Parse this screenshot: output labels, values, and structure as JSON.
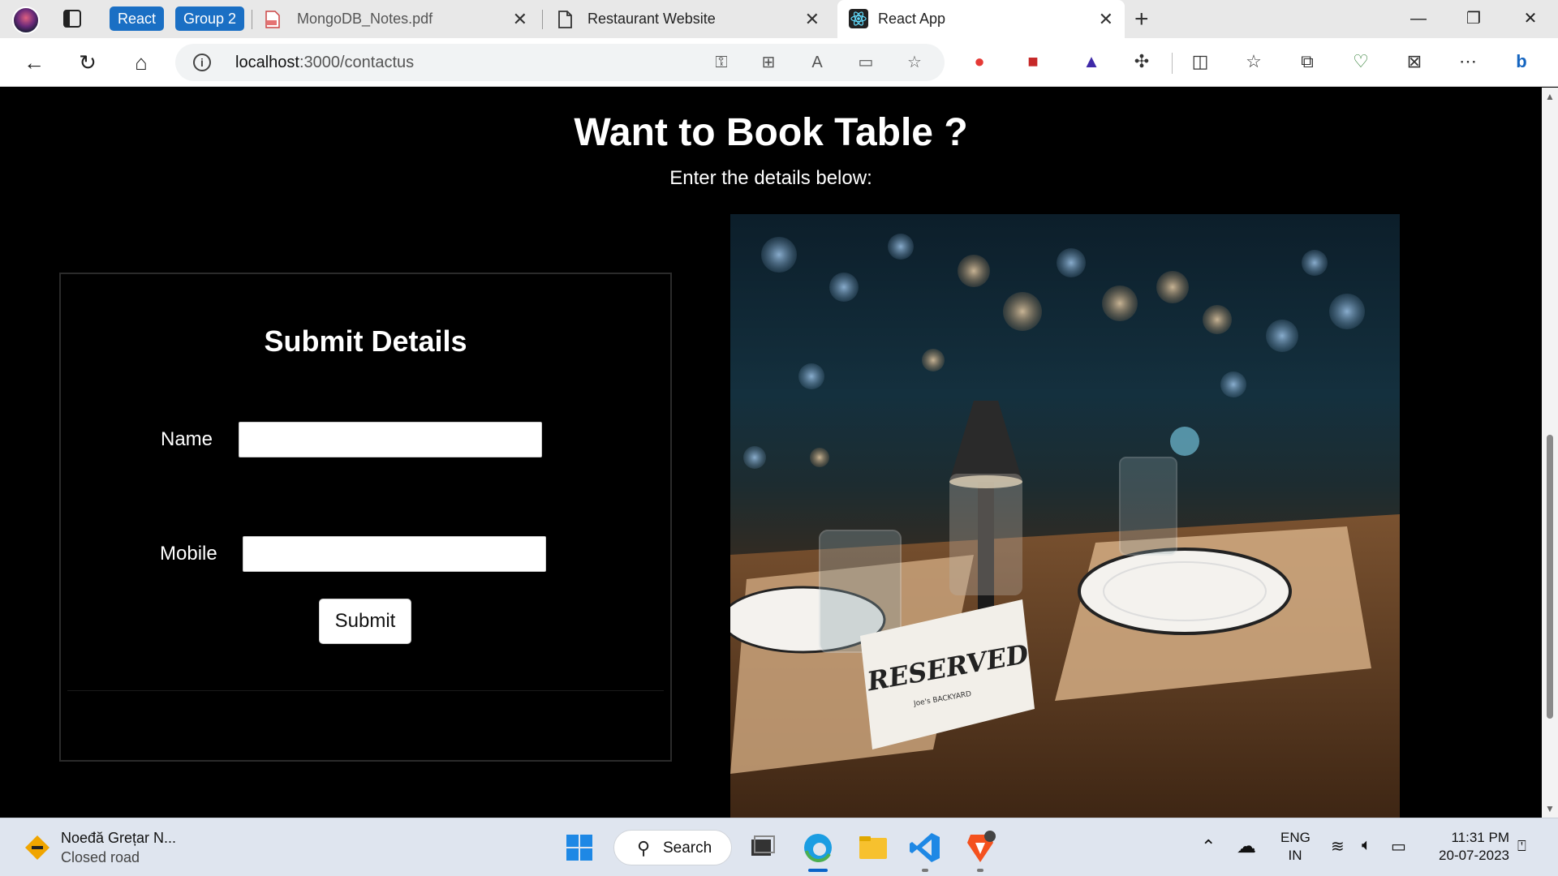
{
  "browser": {
    "tab_groups": [
      {
        "label": "React",
        "color": "#1a6fc4"
      },
      {
        "label": "Group 2",
        "color": "#1a6fc4"
      }
    ],
    "tabs": [
      {
        "title": "MongoDB_Notes.pdf",
        "icon": "pdf-file-icon",
        "active": false
      },
      {
        "title": "Restaurant Website",
        "icon": "document-icon",
        "active": false
      },
      {
        "title": "React App",
        "icon": "react-logo-icon",
        "active": true
      }
    ],
    "url": {
      "host": "localhost",
      "path": ":3000/contactus"
    }
  },
  "page": {
    "heading": "Want to Book Table ?",
    "subheading": "Enter the details below:",
    "form": {
      "title": "Submit Details",
      "name_label": "Name",
      "name_value": "",
      "mobile_label": "Mobile",
      "mobile_value": "",
      "submit_label": "Submit"
    },
    "photo": {
      "subject": "restaurant-table-reserved-photo",
      "sign_text": "RESERVED",
      "sign_subtext": "Joe's BACKYARD"
    }
  },
  "taskbar": {
    "weather_title": "Noeđă Grețar N...",
    "weather_subtitle": "Closed road",
    "search_label": "Search",
    "language_line1": "ENG",
    "language_line2": "IN",
    "time": "11:31 PM",
    "date": "20-07-2023"
  },
  "colors": {
    "page_background": "#000000",
    "tab_group": "#1a6fc4",
    "taskbar": "#dfe5ef"
  }
}
